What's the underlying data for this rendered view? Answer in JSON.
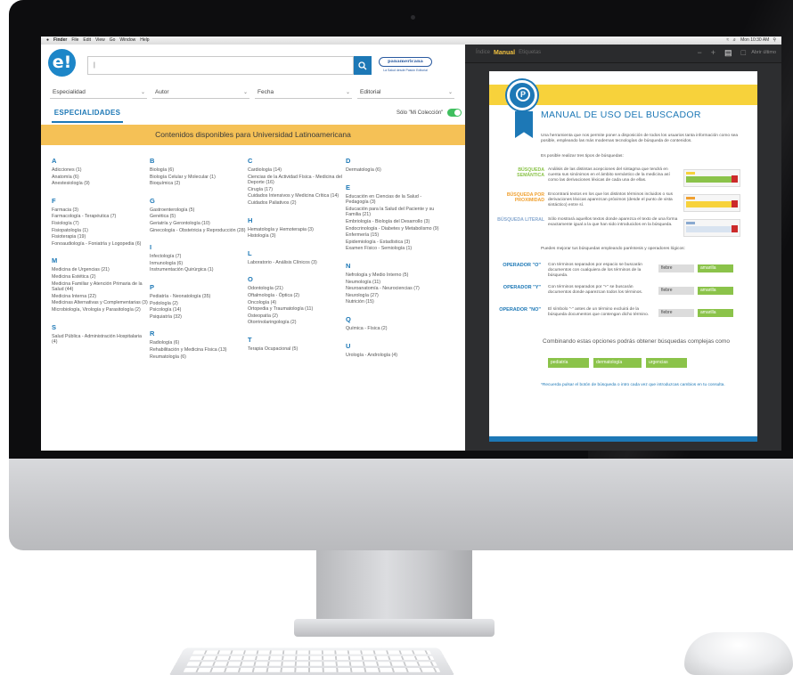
{
  "menubar": {
    "items": [
      "Finder",
      "File",
      "Edit",
      "View",
      "Go",
      "Window",
      "Help"
    ],
    "status": "Mon 10:30 AM"
  },
  "app": {
    "logo_text": "e!",
    "search": {
      "value": "",
      "placeholder": ""
    },
    "publisher": {
      "name": "panamericana",
      "tagline": "La Salud desde Pasión Editorial"
    },
    "filters": [
      "Especialidad",
      "Autor",
      "Fecha",
      "Editorial"
    ],
    "tab": "ESPECIALIDADES",
    "toggle_label": "Sólo \"Mi Colección\"",
    "banner": "Contenidos disponibles para Universidad Latinoamericana",
    "columns": [
      [
        {
          "letter": "A",
          "items": [
            "Adicciones (1)",
            "Anatomía (6)",
            "Anestesiología (9)"
          ]
        },
        {
          "letter": "F",
          "items": [
            "Farmacia (3)",
            "Farmacología - Terapéutica (7)",
            "Fisiología (7)",
            "Fisiopatología (1)",
            "Fisioterapia (19)",
            "Fonoaudiología - Foniatría y Logopedia (6)"
          ]
        },
        {
          "letter": "M",
          "items": [
            "Medicina de Urgencias (21)",
            "Medicina Estética (2)",
            "Medicina Familiar y Atención Primaria de la Salud (44)",
            "Medicina Interna (22)",
            "Medicinas Alternativas y Complementarias (3)",
            "Microbiología, Virología y Parasitología (2)"
          ]
        },
        {
          "letter": "S",
          "items": [
            "Salud Pública - Administración Hospitalaria (4)"
          ]
        }
      ],
      [
        {
          "letter": "B",
          "items": [
            "Biología (6)",
            "Biología Celular y Molecular (1)",
            "Bioquímica (2)"
          ]
        },
        {
          "letter": "G",
          "items": [
            "Gastroenterología (5)",
            "Genética (5)",
            "Geriatría y Gerontología (10)",
            "Ginecología - Obstetricia y Reproducción (28)"
          ]
        },
        {
          "letter": "I",
          "items": [
            "Infectología (7)",
            "Inmunología (6)",
            "Instrumentación Quirúrgica (1)"
          ]
        },
        {
          "letter": "P",
          "items": [
            "Pediatría - Neonatología (35)",
            "Podología (2)",
            "Psicología (14)",
            "Psiquiatría (32)"
          ]
        },
        {
          "letter": "R",
          "items": [
            "Radiología (6)",
            "Rehabilitación y Medicina Física (13)",
            "Reumatología (6)"
          ]
        }
      ],
      [
        {
          "letter": "C",
          "items": [
            "Cardiología (14)",
            "Ciencias de la Actividad Física - Medicina del Deporte (16)",
            "Cirugía (17)",
            "Cuidados Intensivos y Medicina Crítica (14)",
            "Cuidados Paliativos (2)"
          ]
        },
        {
          "letter": "H",
          "items": [
            "Hematología y Hemoterapia (3)",
            "Histología (3)"
          ]
        },
        {
          "letter": "L",
          "items": [
            "Laboratorio - Análisis Clínicos (3)"
          ]
        },
        {
          "letter": "O",
          "items": [
            "Odontología (21)",
            "Oftalmología - Óptica (2)",
            "Oncología (4)",
            "Ortopedia y Traumatología (11)",
            "Osteopatía (2)",
            "Otorrinolaringología (2)"
          ]
        },
        {
          "letter": "T",
          "items": [
            "Terapia Ocupacional (5)"
          ]
        }
      ],
      [
        {
          "letter": "D",
          "items": [
            "Dermatología (6)"
          ]
        },
        {
          "letter": "E",
          "items": [
            "Educación en Ciencias de la Salud - Pedagogía (3)",
            "Educación para la Salud del Paciente y su Familia (21)",
            "Embriología - Biología del Desarrollo (3)",
            "Endocrinología - Diabetes y Metabolismo (9)",
            "Enfermería (15)",
            "Epidemiología - Estadística (3)",
            "Examen Físico - Semiología (1)"
          ]
        },
        {
          "letter": "N",
          "items": [
            "Nefrología y Medio Interno (5)",
            "Neumología (11)",
            "Neuroanatomía - Neurociencias (7)",
            "Neurología (27)",
            "Nutrición (15)"
          ]
        },
        {
          "letter": "Q",
          "items": [
            "Química - Física (2)"
          ]
        },
        {
          "letter": "U",
          "items": [
            "Urología - Andrología (4)"
          ]
        }
      ]
    ]
  },
  "viewer": {
    "tabs": [
      "Índice",
      "Manual",
      "Etiquetas"
    ],
    "right_label": "Abrir último",
    "doc": {
      "title": "MANUAL DE USO DEL BUSCADOR",
      "intro": "Una herramienta que nos permite poner a disposición de todos los usuarios tanta información como sea posible, empleando las más modernas tecnologías de búsqueda de contenidos.",
      "intro2": "Es posible realizar tres tipos de búsquedas:",
      "types": [
        {
          "label": "BÚSQUEDA SEMÁNTICA",
          "text": "Análisis de las distintas acepciones del sintagma que tendrá en cuenta sus sinónimos en el ámbito semántico de la medicina así como las derivaciones léxicas de cada una de ellas."
        },
        {
          "label": "BÚSQUEDA POR PROXIMIDAD",
          "text": "Encontrará textos en los que los distintos términos incluidos o sus derivaciones léxicas aparezcan próximos (desde el punto de vista sintáctico) entre sí."
        },
        {
          "label": "BÚSQUEDA LITERAL",
          "text": "Sólo mostrará aquellos textos donde aparezca el texto de una forma exactamente igual a la que han sido introducidos en la búsqueda."
        }
      ],
      "operators_intro": "Puedes mejorar tus búsquedas empleando paréntesis y operadores lógicos:",
      "operators": [
        {
          "label": "OPERADOR \"O\"",
          "text": "Con términos separados por espacio se buscarán documentos con cualquiera de los términos de la búsqueda.",
          "chips": [
            "fiebre",
            "amarilla"
          ]
        },
        {
          "label": "OPERADOR \"Y\"",
          "text": "Con términos separados por \"+\" se buscarán documentos donde aparezcan todos los términos.",
          "chips": [
            "fiebre",
            "amarilla"
          ]
        },
        {
          "label": "OPERADOR \"NO\"",
          "text": "El símbolo \"-\" antes de un término excluirá de la búsqueda documentos que contengan dicho término.",
          "chips": [
            "fiebre",
            "amarilla"
          ]
        }
      ],
      "combo_text": "Combinando estas opciones podrás obtener búsquedas complejas como",
      "combo_chips": [
        "pediatría",
        "dermatología",
        "urgencias"
      ],
      "footnote": "*Recuerda pulsar el botón de búsqueda o intro cada vez que introduzcas cambios en tu consulta."
    }
  },
  "colors": {
    "brand_blue": "#1d78b6",
    "banner_yellow": "#f5c156",
    "toggle_green": "#3fbf5f",
    "chip_green": "#8bc34a"
  }
}
